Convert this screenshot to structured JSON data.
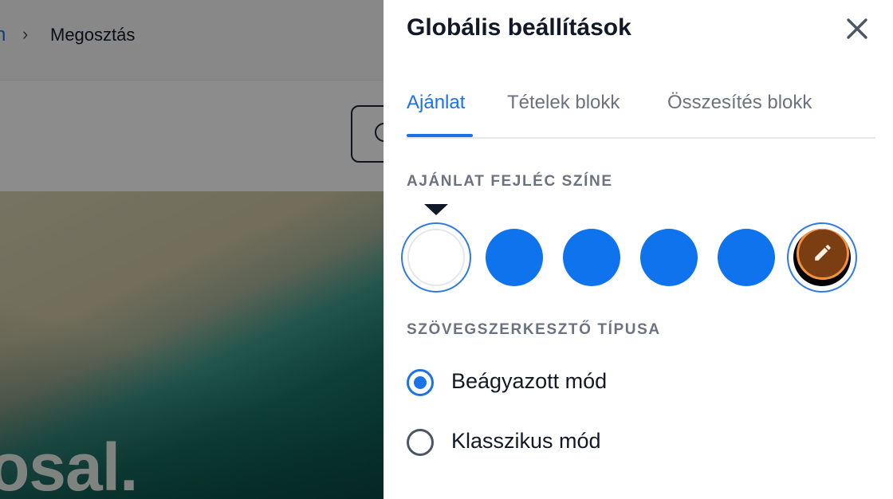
{
  "background": {
    "breadcrumb": {
      "previous": "n",
      "separator": "›",
      "current": "Megosztás"
    },
    "logo_text": "osal."
  },
  "panel": {
    "title": "Globális beállítások",
    "close_icon": "close-icon",
    "tabs": [
      {
        "label": "Ajánlat",
        "active": true
      },
      {
        "label": "Tételek blokk",
        "active": false
      },
      {
        "label": "Összesítés blokk",
        "active": false
      }
    ],
    "header_color": {
      "label": "AJÁNLAT FEJLÉC SZÍNE",
      "swatches": [
        {
          "color": "#ffffff",
          "selected": true
        },
        {
          "color": "#0f73ee",
          "selected": false
        },
        {
          "color": "#0f73ee",
          "selected": false
        },
        {
          "color": "#0f73ee",
          "selected": false
        },
        {
          "color": "#0f73ee",
          "selected": false
        },
        {
          "color": "#7a3e12",
          "selected": false,
          "icon": "pencil-icon",
          "custom": true
        }
      ]
    },
    "editor_type": {
      "label": "SZÖVEGSZERKESZTŐ TÍPUSA",
      "options": [
        {
          "label": "Beágyazott mód",
          "checked": true
        },
        {
          "label": "Klasszikus mód",
          "checked": false
        }
      ]
    }
  }
}
